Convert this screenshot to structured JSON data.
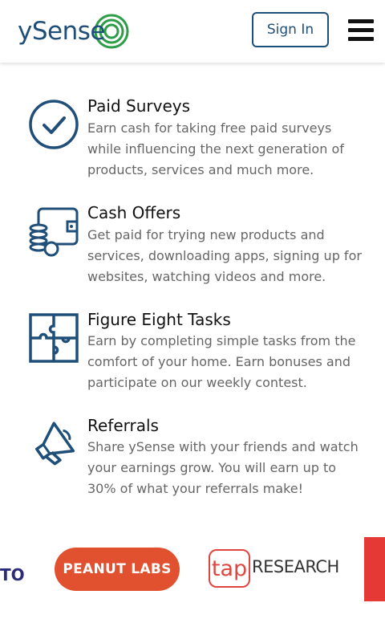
{
  "header": {
    "logo_text": "ySense",
    "signin_label": "Sign In"
  },
  "features": [
    {
      "title": "Paid Surveys",
      "description": "Earn cash for taking free paid surveys while influencing the next generation of products, services and much more.",
      "icon": "checkmark-circle-icon"
    },
    {
      "title": "Cash Offers",
      "description": "Get paid for trying new products and services, downloading apps, signing up for websites, watching videos and more.",
      "icon": "wallet-coins-icon"
    },
    {
      "title": "Figure Eight Tasks",
      "description": "Earn by completing simple tasks from the comfort of your home. Earn bonuses and participate on our weekly contest.",
      "icon": "puzzle-icon"
    },
    {
      "title": "Referrals",
      "description": "Share ySense with your friends and watch your earnings grow. You will earn up to 30% of what your referrals make!",
      "icon": "megaphone-icon"
    }
  ],
  "partners": {
    "left_fragment": "TO",
    "peanut_labs": "PEANUT LABS",
    "tap_mark": "tap",
    "tap_research": "RESEARCH"
  },
  "colors": {
    "brand_navy": "#1f4e79",
    "brand_green": "#2e9d47",
    "peanut_orange": "#e1502f",
    "tap_red": "#e0463f"
  }
}
